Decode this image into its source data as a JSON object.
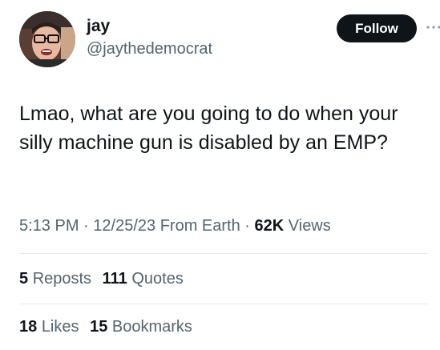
{
  "author": {
    "display_name": "jay",
    "handle": "@jaythedemocrat"
  },
  "follow_label": "Follow",
  "more_icon": "more-horizontal-icon",
  "tweet_text": "Lmao, what are you going to do when your silly machine gun is disabled by an EMP?",
  "meta": {
    "time": "5:13 PM",
    "date": "12/25/23",
    "location": "From Earth",
    "views_count": "62K",
    "views_label": "Views"
  },
  "stats": {
    "reposts_count": "5",
    "reposts_label": "Reposts",
    "quotes_count": "111",
    "quotes_label": "Quotes",
    "likes_count": "18",
    "likes_label": "Likes",
    "bookmarks_count": "15",
    "bookmarks_label": "Bookmarks"
  },
  "colors": {
    "text_primary": "#0f1419",
    "text_secondary": "#536471",
    "follow_bg": "#0f1419",
    "divider": "#e7e9ea"
  }
}
